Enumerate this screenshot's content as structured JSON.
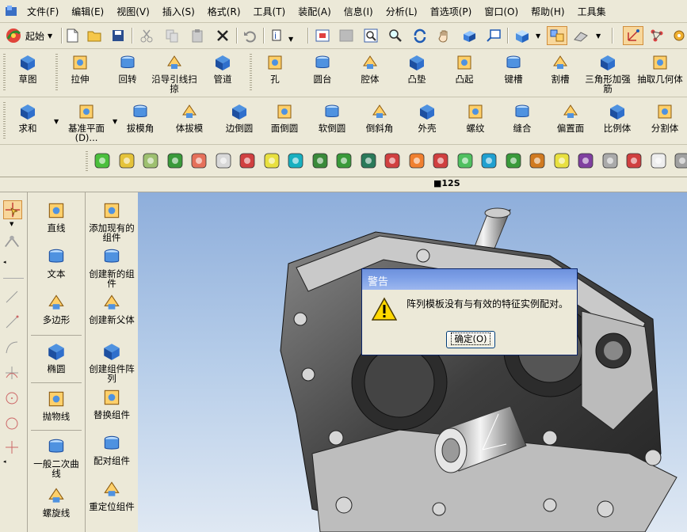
{
  "menu": [
    "文件(F)",
    "编辑(E)",
    "视图(V)",
    "插入(S)",
    "格式(R)",
    "工具(T)",
    "装配(A)",
    "信息(I)",
    "分析(L)",
    "首选项(P)",
    "窗口(O)",
    "帮助(H)",
    "工具集"
  ],
  "standard_toolbar": {
    "start_label": "起始"
  },
  "feature_row1": [
    {
      "label": "草图",
      "icon": "sketch-icon"
    },
    {
      "label": "拉伸",
      "icon": "extrude-icon"
    },
    {
      "label": "回转",
      "icon": "revolve-icon"
    },
    {
      "label": "沿导引线扫掠",
      "icon": "sweep-icon"
    },
    {
      "label": "管道",
      "icon": "tube-icon"
    },
    {
      "label": "孔",
      "icon": "hole-icon"
    },
    {
      "label": "圆台",
      "icon": "boss-icon"
    },
    {
      "label": "腔体",
      "icon": "pocket-icon"
    },
    {
      "label": "凸垫",
      "icon": "pad-icon"
    },
    {
      "label": "凸起",
      "icon": "emboss-icon"
    },
    {
      "label": "键槽",
      "icon": "slot-icon"
    },
    {
      "label": "割槽",
      "icon": "groove-icon"
    },
    {
      "label": "三角形加强筋",
      "icon": "rib-icon"
    },
    {
      "label": "抽取几何体",
      "icon": "extract-icon"
    }
  ],
  "feature_row2": [
    {
      "label": "求和",
      "icon": "unite-icon"
    },
    {
      "label": "基准平面(D)...",
      "icon": "datum-plane-icon"
    },
    {
      "label": "拔模角",
      "icon": "draft-icon"
    },
    {
      "label": "体拔模",
      "icon": "body-draft-icon"
    },
    {
      "label": "边倒圆",
      "icon": "edge-blend-icon"
    },
    {
      "label": "面倒圆",
      "icon": "face-blend-icon"
    },
    {
      "label": "软倒圆",
      "icon": "soft-blend-icon"
    },
    {
      "label": "倒斜角",
      "icon": "chamfer-icon"
    },
    {
      "label": "外壳",
      "icon": "shell-icon"
    },
    {
      "label": "螺纹",
      "icon": "thread-icon"
    },
    {
      "label": "缝合",
      "icon": "sew-icon"
    },
    {
      "label": "偏置面",
      "icon": "offset-face-icon"
    },
    {
      "label": "比例体",
      "icon": "scale-icon"
    },
    {
      "label": "分割体",
      "icon": "split-icon"
    }
  ],
  "strip_text": "■12S",
  "curve_panel": [
    {
      "label": "直线",
      "icon": "line-icon"
    },
    {
      "label": "文本",
      "icon": "text-icon"
    },
    {
      "label": "多边形",
      "icon": "polygon-icon"
    },
    {
      "label": "椭圆",
      "icon": "ellipse-icon"
    },
    {
      "label": "抛物线",
      "icon": "parabola-icon"
    },
    {
      "label": "一般二次曲线",
      "icon": "conic-icon"
    },
    {
      "label": "螺旋线",
      "icon": "helix-icon"
    }
  ],
  "assembly_panel": [
    {
      "label": "添加现有的组件",
      "icon": "add-component-icon"
    },
    {
      "label": "创建新的组件",
      "icon": "create-component-icon"
    },
    {
      "label": "创建新父体",
      "icon": "create-parent-icon"
    },
    {
      "label": "创建组件阵列",
      "icon": "component-array-icon"
    },
    {
      "label": "替换组件",
      "icon": "replace-component-icon"
    },
    {
      "label": "配对组件",
      "icon": "mate-component-icon"
    },
    {
      "label": "重定位组件",
      "icon": "reposition-component-icon"
    }
  ],
  "dialog": {
    "title": "警告",
    "message": "阵列模板没有与有效的特征实例配对。",
    "ok_label": "确定(O)",
    "icon": "warning-icon"
  },
  "colors": {
    "accent": "#f8d79b",
    "dialog_title": "#7b9ee6",
    "viewport_top": "#8eaedb"
  }
}
